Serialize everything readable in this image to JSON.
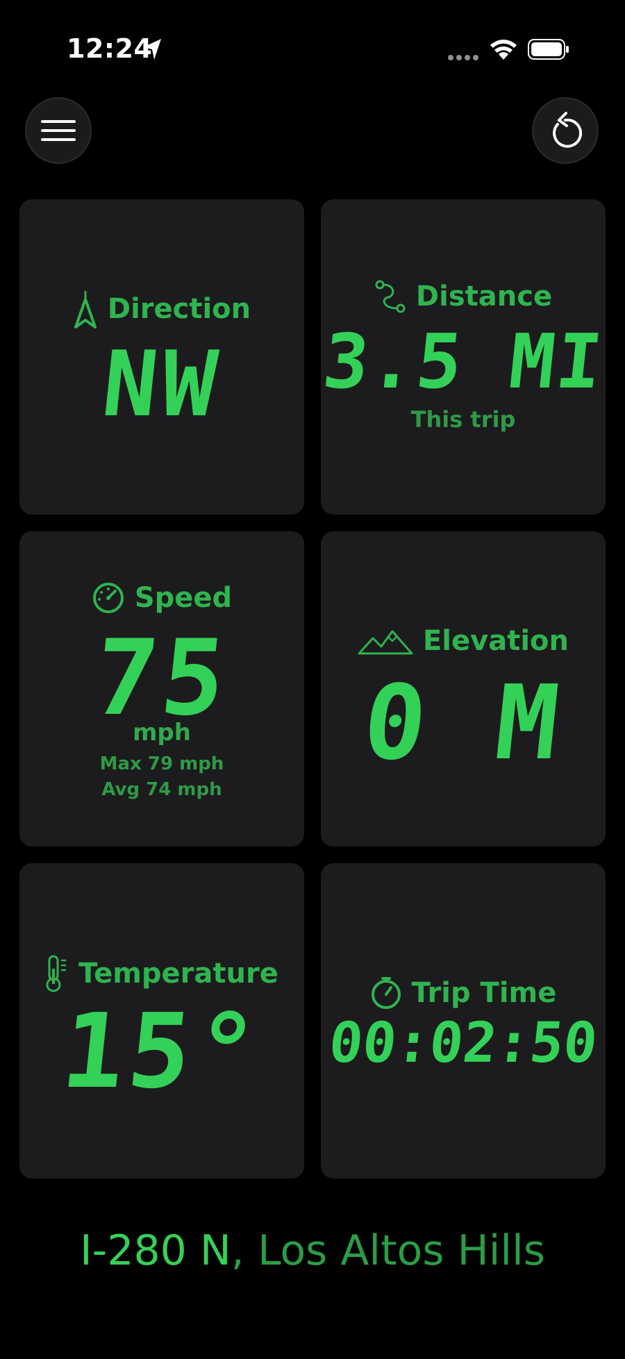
{
  "status_bar": {
    "time": "12:24",
    "icons": [
      "location-arrow-icon",
      "signal-dots-icon",
      "wifi-icon",
      "battery-icon"
    ]
  },
  "toolbar": {
    "menu_icon": "hamburger-menu-icon",
    "reset_icon": "reset-arrow-icon"
  },
  "tiles": {
    "direction": {
      "label": "Direction",
      "value": "NW",
      "icon": "compass-arrow-icon"
    },
    "distance": {
      "label": "Distance",
      "value": "3.5 MI",
      "sub": "This trip",
      "icon": "route-icon"
    },
    "speed": {
      "label": "Speed",
      "value": "75",
      "unit": "mph",
      "max": "Max 79 mph",
      "avg": "Avg 74 mph",
      "icon": "speedometer-icon"
    },
    "elevation": {
      "label": "Elevation",
      "value": "0 M",
      "icon": "mountains-icon"
    },
    "temperature": {
      "label": "Temperature",
      "value": "15°",
      "icon": "thermometer-icon"
    },
    "trip_time": {
      "label": "Trip Time",
      "value": "00:02:50",
      "icon": "timer-icon"
    }
  },
  "footer": {
    "road": "I-280 N",
    "separator": ",",
    "city": " Los Altos Hills"
  },
  "colors": {
    "background": "#000000",
    "tile": "#1c1c1e",
    "accent": "#34d158",
    "label_green": "#2fb44f"
  }
}
